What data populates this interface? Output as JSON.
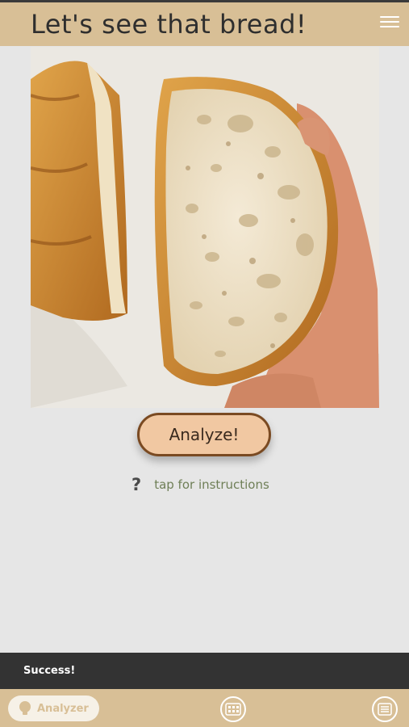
{
  "header": {
    "title": "Let's see that bread!",
    "menu_icon": "hamburger-menu-icon"
  },
  "main": {
    "image_subject": "bread",
    "analyze_label": "Analyze!",
    "help_glyph": "?",
    "instructions_label": "tap for instructions"
  },
  "snackbar": {
    "message": "Success!"
  },
  "bottom_nav": {
    "items": [
      {
        "label": "Analyzer",
        "icon": "lightbulb-icon",
        "active": true
      },
      {
        "label": "",
        "icon": "calendar-grid-icon",
        "active": false
      },
      {
        "label": "",
        "icon": "list-icon",
        "active": false
      }
    ]
  },
  "colors": {
    "header": "#d8bf96",
    "background": "#e6e6e6",
    "button_fill": "#f1c8a2",
    "button_border": "#7a4a22",
    "snackbar": "#333333",
    "instructions_text": "#6f7f57"
  }
}
